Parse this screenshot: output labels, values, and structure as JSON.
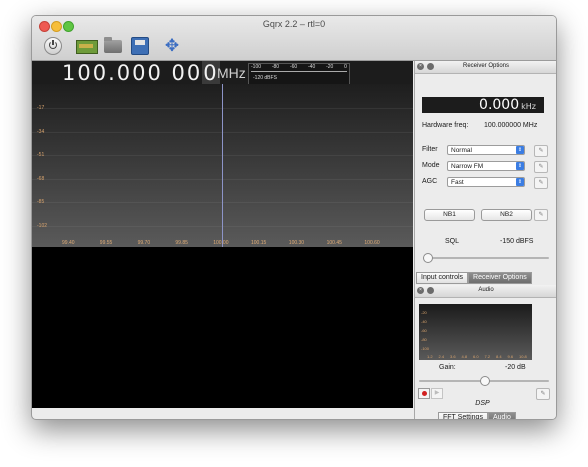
{
  "window": {
    "title": "Gqrx 2.2 – rtl=0"
  },
  "toolbar": {
    "icons": [
      "power-icon",
      "device-icon",
      "folder-icon",
      "save-icon",
      "move-icon"
    ]
  },
  "frequency": {
    "digits_main": "100.000 00",
    "digit_last": "0",
    "unit": "MHz"
  },
  "signal_meter": {
    "scale": [
      "-100",
      "-80",
      "-60",
      "-40",
      "-20",
      "0"
    ],
    "readout": "-120 dBFS"
  },
  "spectrum": {
    "db_labels": [
      "-17",
      "-34",
      "-51",
      "-68",
      "-85",
      "-102"
    ],
    "hz_labels": [
      "99.40",
      "99.55",
      "99.70",
      "99.85",
      "100.00",
      "100.15",
      "100.30",
      "100.45",
      "100.60"
    ]
  },
  "receiver_options": {
    "title": "Receiver Options",
    "offset_value": "0.000",
    "offset_unit": "kHz",
    "hw_label": "Hardware freq:",
    "hw_value": "100.000000 MHz",
    "filter_label": "Filter",
    "filter_value": "Normal",
    "mode_label": "Mode",
    "mode_value": "Narrow FM",
    "agc_label": "AGC",
    "agc_value": "Fast",
    "nb1": "NB1",
    "nb2": "NB2",
    "sql_label": "SQL",
    "sql_value": "-150 dBFS",
    "sql_slider_fraction": 0.0
  },
  "dock_tabs": {
    "input_controls": "Input controls",
    "receiver_options": "Receiver Options"
  },
  "audio": {
    "title": "Audio",
    "db_labels": [
      "-20",
      "-40",
      "-60",
      "-80",
      "-100"
    ],
    "hz_labels": [
      "1.2",
      "2.4",
      "3.6",
      "4.8",
      "6.0",
      "7.2",
      "8.4",
      "9.6",
      "10.8"
    ],
    "gain_label": "Gain:",
    "gain_value": "-20 dB",
    "gain_slider_fraction": 0.5
  },
  "dsp": {
    "label": "DSP",
    "tab_fft": "FFT Settings",
    "tab_audio": "Audio"
  }
}
